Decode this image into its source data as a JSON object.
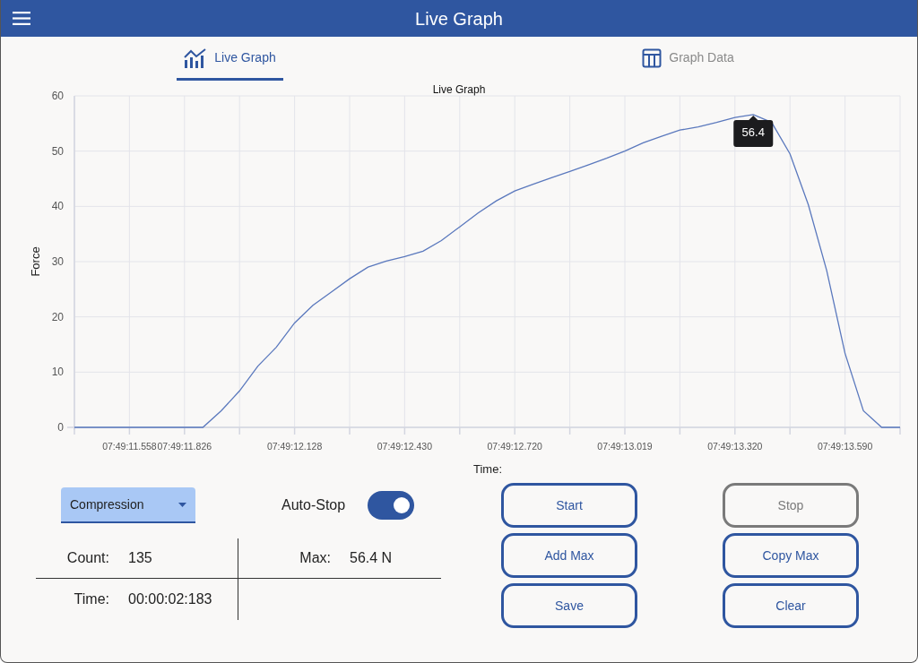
{
  "window": {
    "title": "Live Graph"
  },
  "tabs": [
    {
      "label": "Live Graph",
      "selected": true,
      "kind": "chart"
    },
    {
      "label": "Graph Data",
      "selected": false,
      "kind": "table"
    }
  ],
  "chart": {
    "chart_data": {
      "type": "line",
      "title": "Live Graph",
      "xlabel": "Time:",
      "ylabel": "Force",
      "categories": [
        null,
        null,
        null,
        "07:49:11.558",
        null,
        null,
        "07:49:11.826",
        null,
        null,
        null,
        null,
        null,
        "07:49:12.128",
        null,
        null,
        null,
        null,
        null,
        "07:49:12.430",
        null,
        null,
        null,
        null,
        null,
        "07:49:12.720",
        null,
        null,
        null,
        null,
        null,
        "07:49:13.019",
        null,
        null,
        null,
        null,
        null,
        "07:49:13.320",
        null,
        null,
        null,
        null,
        null,
        "07:49:13.590",
        null,
        null,
        null
      ],
      "series": [
        {
          "color": "#5a78bd",
          "values": [
            0,
            0,
            0,
            0,
            0,
            0,
            0,
            0,
            3.0,
            6.6,
            11.1,
            14.5,
            18.9,
            22.1,
            24.5,
            26.9,
            29.0,
            30.1,
            30.9,
            31.9,
            33.8,
            36.3,
            38.8,
            41.0,
            42.8,
            44.0,
            45.2,
            46.3,
            47.5,
            48.7,
            50.0,
            51.5,
            52.7,
            53.8,
            54.4,
            55.2,
            56.1,
            56.6,
            55.2,
            49.5,
            40.3,
            28.4,
            13.4,
            3.0,
            0,
            0
          ]
        }
      ],
      "ylim": [
        0,
        60
      ],
      "grid": true,
      "yticks": [
        0,
        10,
        20,
        30,
        40,
        50,
        60
      ],
      "annotations": [
        {
          "y": 56.6,
          "text": "56.4"
        }
      ]
    }
  },
  "mode_select": {
    "value": "Compression"
  },
  "auto_stop": {
    "label": "Auto-Stop",
    "on": true
  },
  "stats": [
    {
      "label": "Count:",
      "value": "135"
    },
    {
      "label": "Max:",
      "value": "56.4 N"
    },
    {
      "label": "Time:",
      "value": "00:00:02:183"
    }
  ],
  "buttons": [
    {
      "label": "Start",
      "disabled": false
    },
    {
      "label": "Stop",
      "disabled": true
    },
    {
      "label": "Add Max",
      "disabled": false
    },
    {
      "label": "Copy Max",
      "disabled": false
    },
    {
      "label": "Save",
      "disabled": false
    },
    {
      "label": "Clear",
      "disabled": false
    }
  ]
}
